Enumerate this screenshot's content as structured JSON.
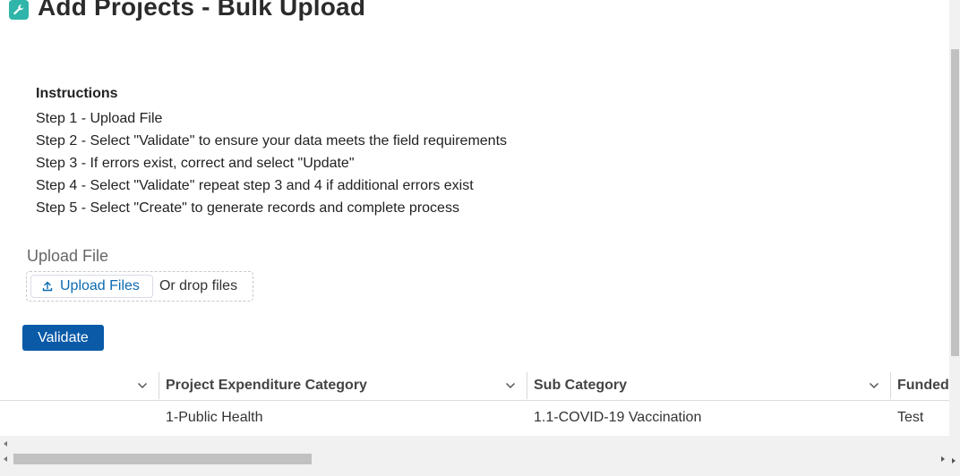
{
  "page": {
    "title": "Add Projects - Bulk Upload"
  },
  "instructions": {
    "heading": "Instructions",
    "steps": [
      "Step 1 - Upload File",
      "Step 2 - Select \"Validate\" to ensure your data meets the field requirements",
      "Step 3 - If errors exist, correct and select \"Update\"",
      "Step 4 - Select \"Validate\" repeat step 3 and 4 if additional errors exist",
      "Step 5 - Select \"Create\" to generate records and complete process"
    ]
  },
  "upload": {
    "label": "Upload File",
    "button_label": "Upload Files",
    "drop_text": "Or drop files"
  },
  "actions": {
    "validate_label": "Validate"
  },
  "table": {
    "columns": [
      "",
      "Project Expenditure Category",
      "Sub Category",
      "Funded"
    ],
    "rows": [
      [
        "",
        "1-Public Health",
        "1.1-COVID-19 Vaccination",
        "Test"
      ]
    ]
  },
  "colors": {
    "accent": "#0a5aa8",
    "link": "#0b6bb3",
    "icon_bg": "#2fb5a9"
  },
  "icons": {
    "header": "wrench-icon",
    "upload": "upload-icon",
    "column_menu": "chevron-down-icon"
  }
}
